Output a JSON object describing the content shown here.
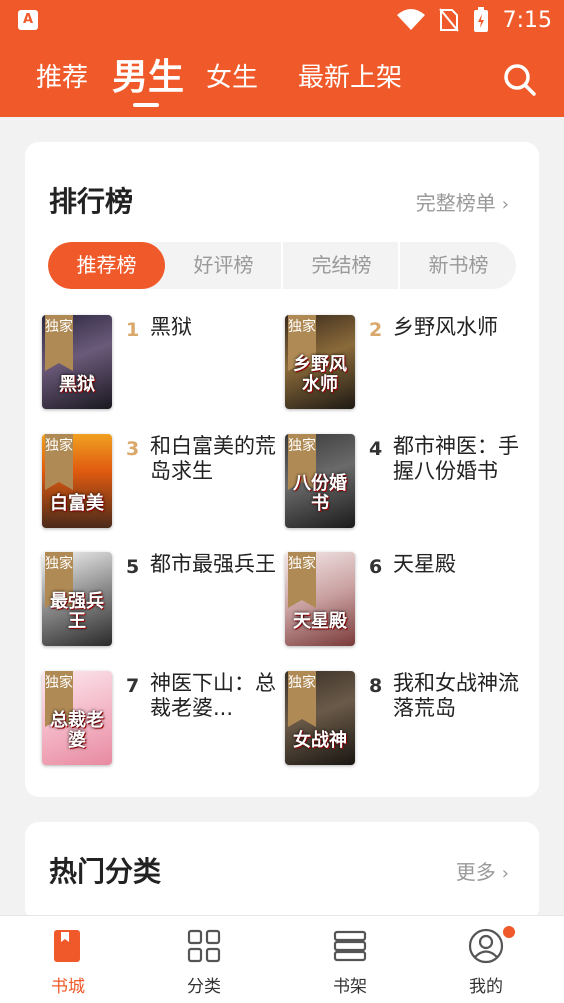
{
  "status_bar": {
    "time": "7:15",
    "app_badge": "A"
  },
  "top_tabs": [
    {
      "label": "推荐"
    },
    {
      "label": "男生",
      "active": true
    },
    {
      "label": "女生"
    },
    {
      "label": "最新上架"
    }
  ],
  "ranking": {
    "title": "排行榜",
    "more_label": "完整榜单",
    "tabs": [
      {
        "label": "推荐榜",
        "active": true
      },
      {
        "label": "好评榜"
      },
      {
        "label": "完结榜"
      },
      {
        "label": "新书榜"
      }
    ],
    "badge_label": "独家",
    "books": [
      {
        "rank": "1",
        "title": "黑狱",
        "cover_text": "黑狱",
        "rank_color": "#d9a86a",
        "cover_bg": "linear-gradient(160deg,#2b2840 0%,#6b5a7a 45%,#1a1820 100%)"
      },
      {
        "rank": "2",
        "title": "乡野风水师",
        "cover_text": "乡野风水师",
        "rank_color": "#d9a86a",
        "cover_bg": "linear-gradient(160deg,#3a2a1c 0%,#8a6a3a 45%,#1e1a14 100%)"
      },
      {
        "rank": "3",
        "title": "和白富美的荒岛求生",
        "cover_text": "白富美",
        "rank_color": "#d9a86a",
        "cover_bg": "linear-gradient(180deg,#f0a020 0%,#e05a10 40%,#4a2a1a 100%)"
      },
      {
        "rank": "4",
        "title": "都市神医：手握八份婚书",
        "cover_text": "八份婚书",
        "rank_color": "#333333",
        "cover_bg": "linear-gradient(160deg,#3a3a3a 0%,#6a6a6a 45%,#1a1a1a 100%)"
      },
      {
        "rank": "5",
        "title": "都市最强兵王",
        "cover_text": "最强兵王",
        "rank_color": "#333333",
        "cover_bg": "linear-gradient(160deg,#f4f4f4 0%,#8a8a8a 50%,#2a2a2a 100%)"
      },
      {
        "rank": "6",
        "title": "天星殿",
        "cover_text": "天星殿",
        "rank_color": "#333333",
        "cover_bg": "linear-gradient(160deg,#f4e8e8 0%,#c9a0a0 50%,#7a3a3a 100%)"
      },
      {
        "rank": "7",
        "title": "神医下山：总裁老婆...",
        "cover_text": "总裁老婆",
        "rank_color": "#333333",
        "cover_bg": "linear-gradient(160deg,#fbe8ee 0%,#f4b8c8 50%,#e88aa0 100%)"
      },
      {
        "rank": "8",
        "title": "我和女战神流落荒岛",
        "cover_text": "女战神",
        "rank_color": "#333333",
        "cover_bg": "linear-gradient(160deg,#3a3028 0%,#6a5a48 45%,#1a1612 100%)"
      }
    ]
  },
  "categories": {
    "title": "热门分类",
    "more_label": "更多"
  },
  "bottom_nav": [
    {
      "label": "书城",
      "icon": "book-city-icon",
      "active": true
    },
    {
      "label": "分类",
      "icon": "category-grid-icon"
    },
    {
      "label": "书架",
      "icon": "bookshelf-icon"
    },
    {
      "label": "我的",
      "icon": "profile-icon",
      "has_dot": true
    }
  ],
  "colors": {
    "accent": "#f05a2a",
    "gold_badge": "#b08a55"
  }
}
